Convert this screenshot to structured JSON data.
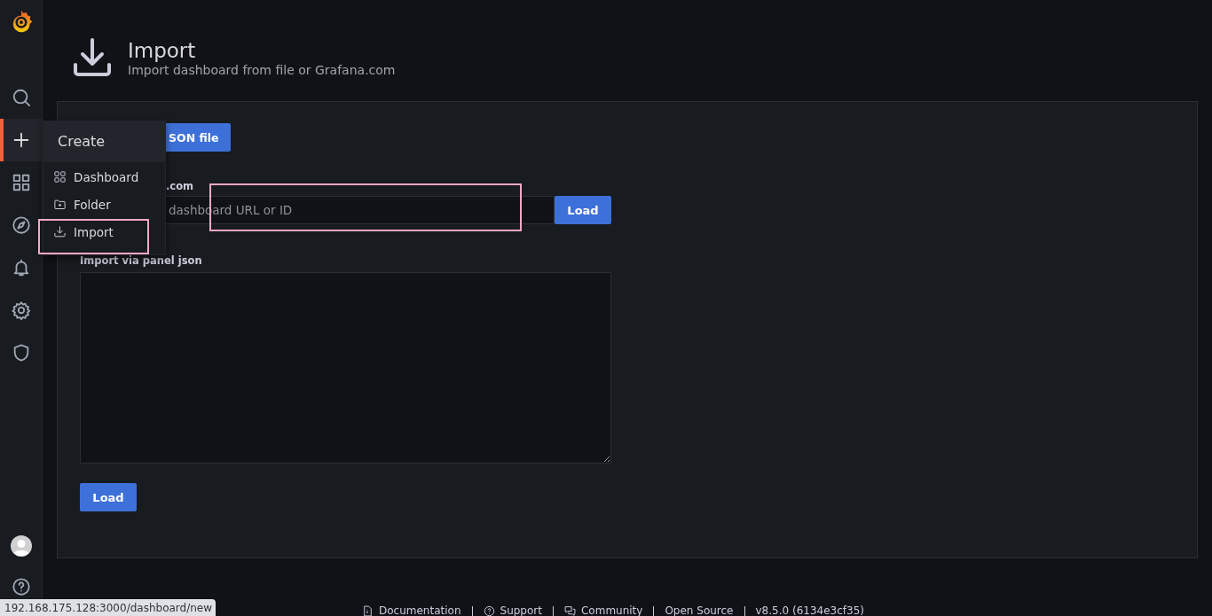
{
  "sidebar": {
    "items": [
      {
        "kind": "search",
        "selected": false
      },
      {
        "kind": "create",
        "selected": true
      },
      {
        "kind": "dashboards",
        "selected": false
      },
      {
        "kind": "explore",
        "selected": false
      },
      {
        "kind": "alerting",
        "selected": false
      },
      {
        "kind": "settings",
        "selected": false
      },
      {
        "kind": "shield",
        "selected": false
      }
    ],
    "bottom": [
      {
        "kind": "avatar"
      },
      {
        "kind": "help"
      }
    ]
  },
  "create_menu": {
    "title": "Create",
    "items": [
      {
        "kind": "dashboard",
        "label": "Dashboard",
        "highlighted": false
      },
      {
        "kind": "folder",
        "label": "Folder",
        "highlighted": false
      },
      {
        "kind": "import",
        "label": "Import",
        "highlighted": true
      }
    ]
  },
  "page": {
    "title": "Import",
    "subtitle": "Import dashboard from file or Grafana.com"
  },
  "panel": {
    "upload_button": "SON file",
    "url_label": ".com",
    "url_field": {
      "placeholder": "dashboard URL or ID",
      "highlighted": true
    },
    "url_load_button": "Load",
    "json_label": "Import via panel json",
    "json_load_button": "Load"
  },
  "footer": [
    {
      "kind": "doc",
      "label": "Documentation"
    },
    {
      "kind": "help",
      "label": "Support"
    },
    {
      "kind": "chat",
      "label": "Community"
    },
    {
      "kind": "none",
      "label": "Open Source"
    },
    {
      "kind": "none",
      "label": "v8.5.0 (6134e3cf35)"
    }
  ],
  "status_url": "192.168.175.128:3000/dashboard/new"
}
